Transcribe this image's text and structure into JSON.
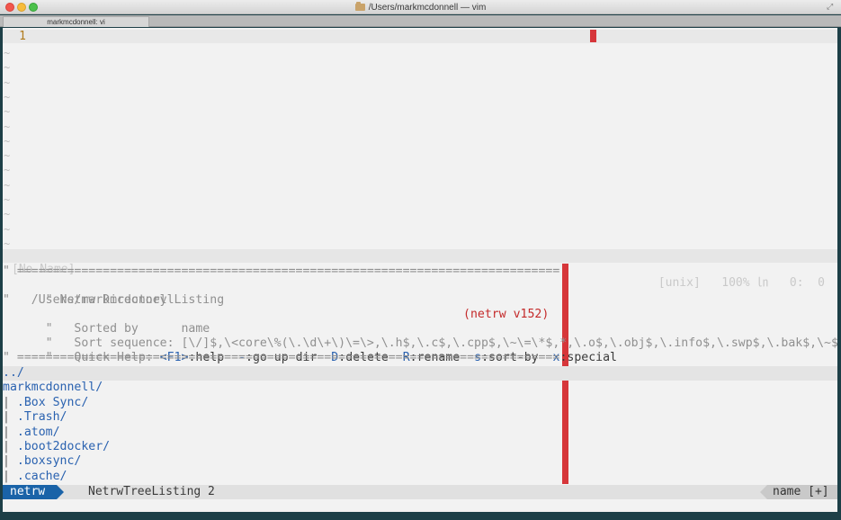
{
  "window": {
    "title": "/Users/markmcdonnell — vim",
    "tab_label": "markmcdonnell: vi"
  },
  "top_buffer": {
    "line_number": "1",
    "status": {
      "name": "[No Name]",
      "right": "[unix]   100% ㏑   0:  0"
    }
  },
  "netrw": {
    "banner": [
      "\" ============================================================================",
      "\" Netrw Directory Listing",
      "\"   /Users/markmcdonnell",
      "\"   Sorted by      name",
      "\"   Sort sequence: [\\/]$,\\<core\\%(\\.\\d\\+\\)\\=\\>,\\.h$,\\.c$,\\.cpp$,\\~\\=\\*$,*,\\.o$,\\.obj$,\\.info$,\\.swp$,\\.bak$,\\~$",
      "\"   Quick Help: ",
      "\" ============================================================================"
    ],
    "version": "(netrw v152)",
    "quick_help": [
      {
        "key": "<F1>",
        "desc": ":help"
      },
      {
        "key": "-",
        "desc": ":go up dir"
      },
      {
        "key": "D",
        "desc": ":delete"
      },
      {
        "key": "R",
        "desc": ":rename"
      },
      {
        "key": "s",
        "desc": ":sort-by"
      },
      {
        "key": "x",
        "desc": ":special"
      }
    ],
    "entries": [
      {
        "prefix": "",
        "name": "../"
      },
      {
        "prefix": "",
        "name": "markmcdonnell/"
      },
      {
        "prefix": "| ",
        "name": ".Box Sync/"
      },
      {
        "prefix": "| ",
        "name": ".Trash/"
      },
      {
        "prefix": "| ",
        "name": ".atom/"
      },
      {
        "prefix": "| ",
        "name": ".boot2docker/"
      },
      {
        "prefix": "| ",
        "name": ".boxsync/"
      },
      {
        "prefix": "| ",
        "name": ".cache/"
      }
    ],
    "status": {
      "mode": "netrw",
      "file": "NetrwTreeListing 2",
      "right": "name [+]"
    }
  },
  "colors": {
    "colorcolumn": "#d6363a",
    "mode_bg": "#1a63a8",
    "directory": "#2a62b0",
    "version": "#c42a2a"
  }
}
